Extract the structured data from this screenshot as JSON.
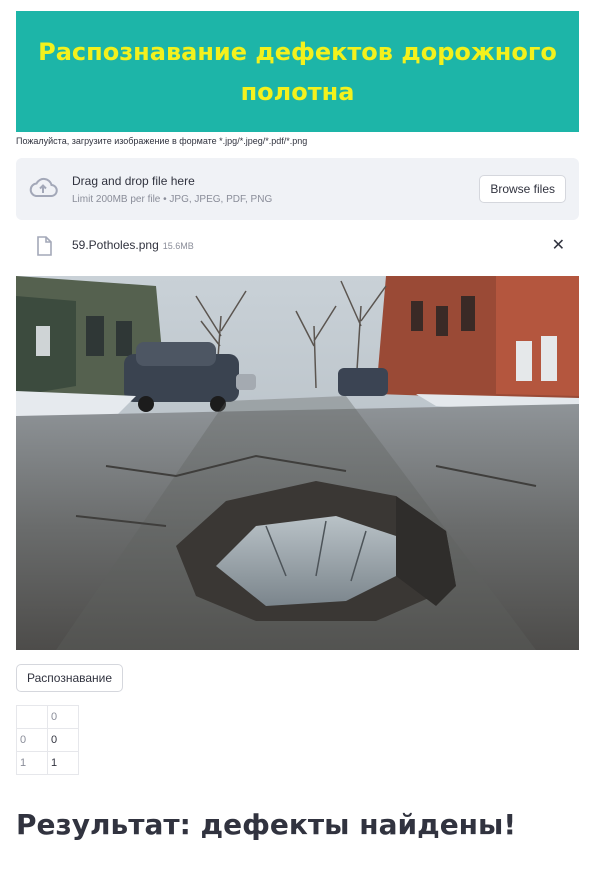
{
  "header": {
    "title": "Распознавание дефектов дорожного полотна",
    "bg_color": "#1db5a8",
    "title_color": "#f3f11d"
  },
  "uploader": {
    "label": "Пожалуйста, загрузите изображение в формате *.jpg/*.jpeg/*.pdf/*.png",
    "drop_title": "Drag and drop file here",
    "limit_text": "Limit 200MB per file • JPG, JPEG, PDF, PNG",
    "browse_label": "Browse files",
    "icon": "cloud-upload-icon"
  },
  "file": {
    "name": "59.Potholes.png",
    "size": "15.6MB",
    "icon": "file-icon",
    "remove_icon": "close-icon",
    "remove_glyph": "✕"
  },
  "image": {
    "description_icon": "pothole-photo"
  },
  "actions": {
    "recognize_label": "Распознавание"
  },
  "dataframe": {
    "header": [
      "",
      "0"
    ],
    "rows": [
      {
        "index": "0",
        "value": "0"
      },
      {
        "index": "1",
        "value": "1"
      }
    ]
  },
  "result": {
    "text": "Результат: дефекты найдены!"
  }
}
